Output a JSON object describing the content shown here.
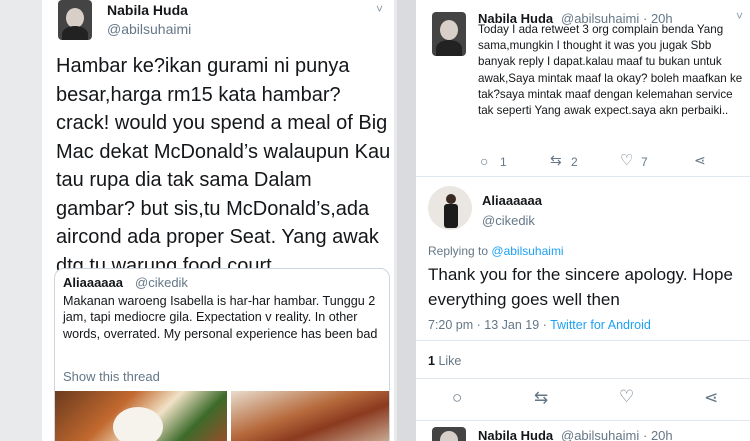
{
  "left_tweet": {
    "name": "Nabila Huda",
    "handle": "@abilsuhaimi",
    "text": "Hambar ke?ikan gurami ni punya besar,harga rm15 kata hambar?crack! would you spend a meal of Big Mac dekat McDonald’s walaupun Kau tau rupa dia tak sama Dalam gambar? but sis,tu McDonald’s,ada aircond ada proper Seat. Yang awak dtg tu,warung,food court..",
    "quoted": {
      "name": "Aliaaaaaa",
      "handle": "@cikedik",
      "text": "Makanan waroeng Isabella is har-har hambar. Tunggu 2 jam, tapi mediocre gila. Expectation v reality. In other words, overrated. My personal experience has been bad",
      "show_thread": "Show this thread"
    }
  },
  "right_thread": {
    "top_tweet": {
      "name": "Nabila Huda",
      "handle": "@abilsuhaimi",
      "time": "· 20h",
      "text": "Today I ada retweet 3 org complain benda Yang sama,mungkin I thought it was you jugak Sbb banyak reply I dapat.kalau maaf tu bukan untuk awak,Saya mintak maaf la okay? boleh maafkan ke tak?saya mintak maaf dengan kelemahan service tak seperti Yang awak expect.saya akn perbaiki..",
      "reply_count": "1",
      "retweet_count": "2",
      "like_count": "7"
    },
    "main_tweet": {
      "name": "Aliaaaaaa",
      "handle": "@cikedik",
      "replying_label": "Replying to",
      "replying_to": "@abilsuhaimi",
      "text": "Thank you for the sincere apology. Hope everything goes well then",
      "timestamp": "7:20 pm · 13 Jan 19 · ",
      "app": "Twitter for Android",
      "likes_count": "1",
      "likes_label": "Like"
    },
    "bottom_tweet": {
      "name": "Nabila Huda",
      "handle": "@abilsuhaimi",
      "time": "· 20h"
    }
  },
  "icons": {
    "caret": "˅",
    "reply": "○",
    "retweet": "⇆",
    "like": "♡",
    "share": "⋖"
  }
}
